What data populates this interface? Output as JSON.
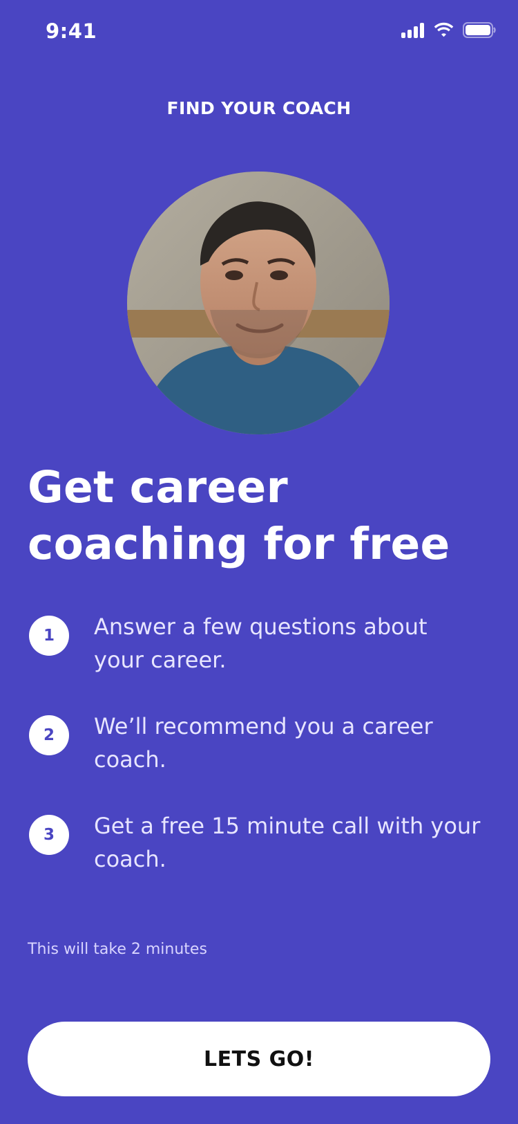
{
  "status_bar": {
    "time": "9:41",
    "icons": [
      "signal-icon",
      "wifi-icon",
      "battery-icon"
    ]
  },
  "header": {
    "title": "FIND YOUR COACH"
  },
  "avatar": {
    "icon": "coach-avatar-photo"
  },
  "main": {
    "headline": "Get career coaching for free",
    "steps": [
      {
        "number": "1",
        "text": "Answer a few questions about your career."
      },
      {
        "number": "2",
        "text": "We’ll recommend you a career coach."
      },
      {
        "number": "3",
        "text": "Get a free 15 minute call with your coach."
      }
    ],
    "time_note": "This will take 2 minutes",
    "cta_label": "LETS GO!"
  },
  "colors": {
    "background": "#4a45c2",
    "button": "#ffffff",
    "button_text": "#111111"
  }
}
